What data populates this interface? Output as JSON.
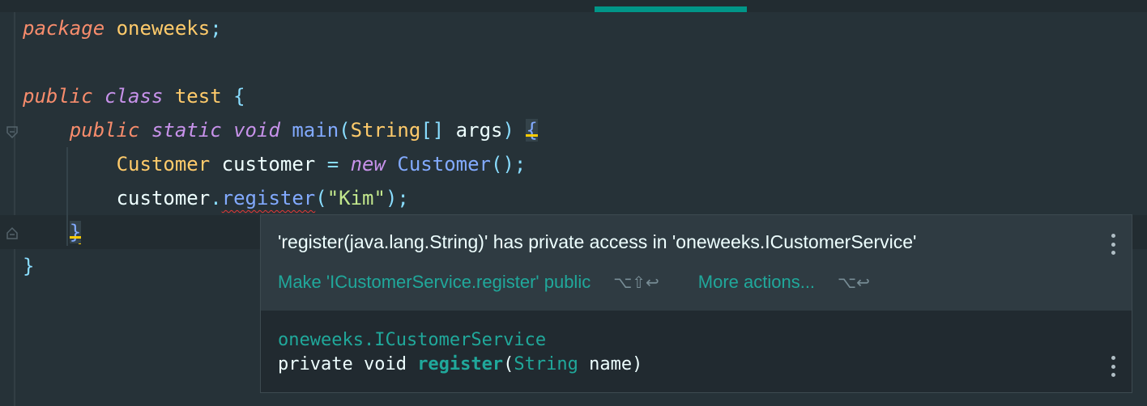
{
  "editor": {
    "lines": [
      [
        {
          "t": "package",
          "c": "kw-pkg"
        },
        {
          "t": " ",
          "c": "plain"
        },
        {
          "t": "oneweeks",
          "c": "cls"
        },
        {
          "t": ";",
          "c": "semi"
        }
      ],
      [],
      [
        {
          "t": "public",
          "c": "kw-pkg"
        },
        {
          "t": " ",
          "c": "plain"
        },
        {
          "t": "class",
          "c": "kw"
        },
        {
          "t": " ",
          "c": "plain"
        },
        {
          "t": "test",
          "c": "cls"
        },
        {
          "t": " ",
          "c": "plain"
        },
        {
          "t": "{",
          "c": "punc"
        }
      ],
      [
        {
          "t": "    ",
          "c": "plain"
        },
        {
          "t": "public",
          "c": "kw-pkg"
        },
        {
          "t": " ",
          "c": "plain"
        },
        {
          "t": "static",
          "c": "kw"
        },
        {
          "t": " ",
          "c": "plain"
        },
        {
          "t": "void",
          "c": "kw"
        },
        {
          "t": " ",
          "c": "plain"
        },
        {
          "t": "main",
          "c": "fn"
        },
        {
          "t": "(",
          "c": "punc"
        },
        {
          "t": "String",
          "c": "cls"
        },
        {
          "t": "[]",
          "c": "punc"
        },
        {
          "t": " args",
          "c": "plain"
        },
        {
          "t": ")",
          "c": "punc"
        },
        {
          "t": " ",
          "c": "plain"
        },
        {
          "t": "{",
          "c": "brace-hl"
        }
      ],
      [
        {
          "t": "        ",
          "c": "plain"
        },
        {
          "t": "Customer",
          "c": "cls"
        },
        {
          "t": " customer ",
          "c": "plain"
        },
        {
          "t": "=",
          "c": "punc"
        },
        {
          "t": " ",
          "c": "plain"
        },
        {
          "t": "new",
          "c": "kw"
        },
        {
          "t": " ",
          "c": "plain"
        },
        {
          "t": "Customer",
          "c": "fn"
        },
        {
          "t": "();",
          "c": "punc"
        }
      ],
      [
        {
          "t": "        ",
          "c": "plain"
        },
        {
          "t": "customer",
          "c": "plain"
        },
        {
          "t": ".",
          "c": "punc"
        },
        {
          "t": "register",
          "c": "fn err"
        },
        {
          "t": "(",
          "c": "punc"
        },
        {
          "t": "\"Kim\"",
          "c": "str"
        },
        {
          "t": ");",
          "c": "punc"
        }
      ],
      [
        {
          "t": "    ",
          "c": "plain"
        },
        {
          "t": "}",
          "c": "brace-hl"
        }
      ],
      [
        {
          "t": "}",
          "c": "punc"
        }
      ]
    ]
  },
  "popup": {
    "message": "'register(java.lang.String)' has private access in 'oneweeks.ICustomerService'",
    "action_primary": "Make 'ICustomerService.register' public",
    "action_primary_shortcut": "⌥⇧↩",
    "action_more": "More actions...",
    "action_more_shortcut": "⌥↩",
    "doc_fqn": "oneweeks.ICustomerService",
    "doc_modifiers": "private void ",
    "doc_method": "register",
    "doc_paren_open": "(",
    "doc_param_type": "String",
    "doc_param_name": " name)"
  },
  "colors": {
    "editor_bg": "#263238",
    "accent": "#009688",
    "keyword": "#C792EA",
    "type": "#FFCB6B",
    "function": "#82AAFF",
    "string": "#C3E88D",
    "link": "#20A89B",
    "error_underline": "#E53935"
  }
}
